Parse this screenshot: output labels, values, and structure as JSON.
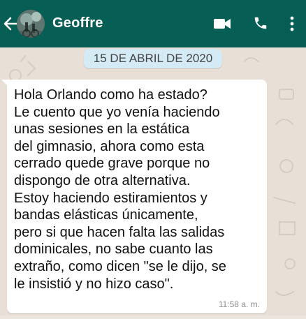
{
  "header": {
    "contact_name": "Geoffre",
    "back_icon": "arrow-left-icon",
    "actions": [
      "video-call-icon",
      "phone-icon",
      "more-vertical-icon"
    ],
    "background_color": "#075e54"
  },
  "chat": {
    "date_label": "15 DE ABRIL DE 2020",
    "message": {
      "text": "Hola Orlando como ha estado?\nLe cuento que yo venía haciendo\nunas sesiones en la estática\ndel gimnasio, ahora como esta\ncerrado quede grave porque no\ndispongo de otra alternativa.\nEstoy haciendo estiramientos y\nbandas elásticas únicamente,\npero si que hacen falta las salidas\ndominicales, no sabe cuanto las\nextraño, como dicen \"se le dijo, se\nle insistió y no hizo caso\".",
      "time": "11:58 a. m."
    }
  }
}
